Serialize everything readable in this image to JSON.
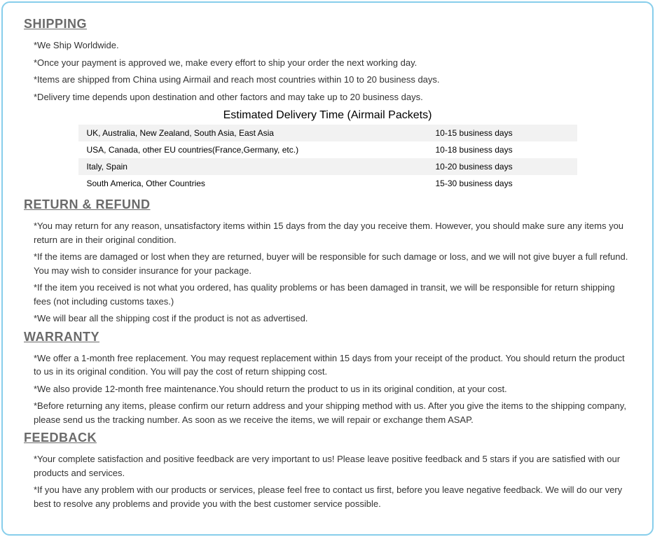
{
  "shipping": {
    "heading": "SHIPPING",
    "bullets": [
      "*We Ship Worldwide.",
      "*Once your payment is approved we, make every effort to ship your order the next working day.",
      "*Items are shipped from China using Airmail and reach most countries within 10 to 20 business days.",
      "*Delivery time depends upon destination and other factors and may take up to 20 business days."
    ],
    "table_title": "Estimated Delivery Time (Airmail Packets)",
    "table_rows": [
      {
        "region": "UK, Australia, New Zealand, South Asia, East Asia",
        "time": "10-15 business days"
      },
      {
        "region": "USA, Canada, other EU countries(France,Germany, etc.)",
        "time": "10-18 business days"
      },
      {
        "region": "Italy, Spain",
        "time": "10-20 business days"
      },
      {
        "region": "South America, Other Countries",
        "time": "15-30 business days"
      }
    ]
  },
  "return": {
    "heading": "RETURN & REFUND",
    "bullets": [
      "*You may return for any reason, unsatisfactory items within 15 days from the day you receive them. However, you should make sure any items you return are in their original condition.",
      "*If the items are damaged or lost when they are returned, buyer will be responsible for such damage or loss, and we will not give buyer a full refund. You may wish to consider insurance for your package.",
      "*If the item you received is not what you ordered, has quality problems or has been damaged in transit, we will be responsible for return shipping fees (not including customs taxes.)",
      "*We will bear all the shipping cost if the product is not as advertised."
    ]
  },
  "warranty": {
    "heading": "WARRANTY",
    "bullets": [
      "*We offer a 1-month free replacement.  You may request replacement within 15 days from your receipt of the product. You should return the product to us in its original condition. You will pay the cost of return shipping cost.",
      "*We also provide 12-month free maintenance.You should return the product to us in its original condition, at your cost.",
      "*Before returning any items, please confirm our return address and your shipping method with us. After you give the items to the shipping company, please send us the tracking number. As soon as we receive the items, we will repair or exchange them ASAP."
    ]
  },
  "feedback": {
    "heading": "FEEDBACK",
    "bullets": [
      "*Your complete satisfaction and positive feedback are very important to us!  Please leave positive feedback and 5 stars if you are satisfied with our products and services.",
      "*If you have any problem with our products or services, please feel free to contact us first, before you leave negative feedback.  We will do our very best to resolve any problems and provide you with the best customer service possible."
    ]
  }
}
